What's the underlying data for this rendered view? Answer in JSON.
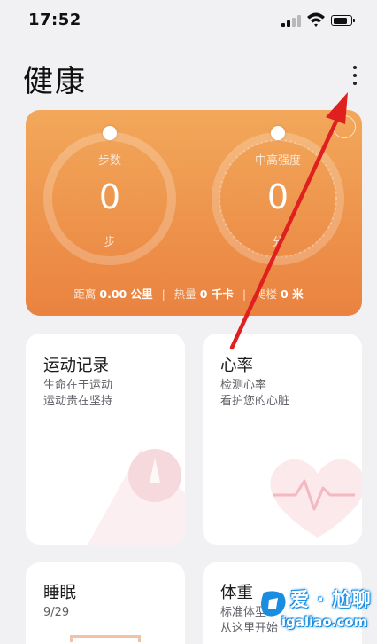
{
  "status_bar": {
    "time": "17:52",
    "battery_level": 0.85
  },
  "header": {
    "title": "健康",
    "more_icon": "more-vertical-icon"
  },
  "activity_card": {
    "colors": {
      "top": "#f2a85a",
      "bottom": "#ea8240"
    },
    "steps": {
      "label": "步数",
      "value": "0",
      "unit": "步"
    },
    "intensity": {
      "label": "中高强度",
      "value": "0",
      "unit": "分"
    },
    "summary": {
      "distance_label": "距离",
      "distance_value": "0.00 公里",
      "calories_label": "热量",
      "calories_value": "0 千卡",
      "floors_label": "爬楼",
      "floors_value": "0 米",
      "separator": "|"
    }
  },
  "tiles": {
    "exercise": {
      "title": "运动记录",
      "line1": "生命在于运动",
      "line2": "运动贵在坚持"
    },
    "heart_rate": {
      "title": "心率",
      "line1": "检测心率",
      "line2": "看护您的心脏"
    },
    "sleep": {
      "title": "睡眠",
      "line1": "9/29"
    },
    "weight": {
      "title": "体重",
      "line1": "标准体型",
      "line2": "从这里开始"
    }
  },
  "annotation": {
    "color": "#e0201e"
  },
  "watermark": {
    "text": "爱 · 尬聊",
    "domain": "igaliao.com"
  }
}
